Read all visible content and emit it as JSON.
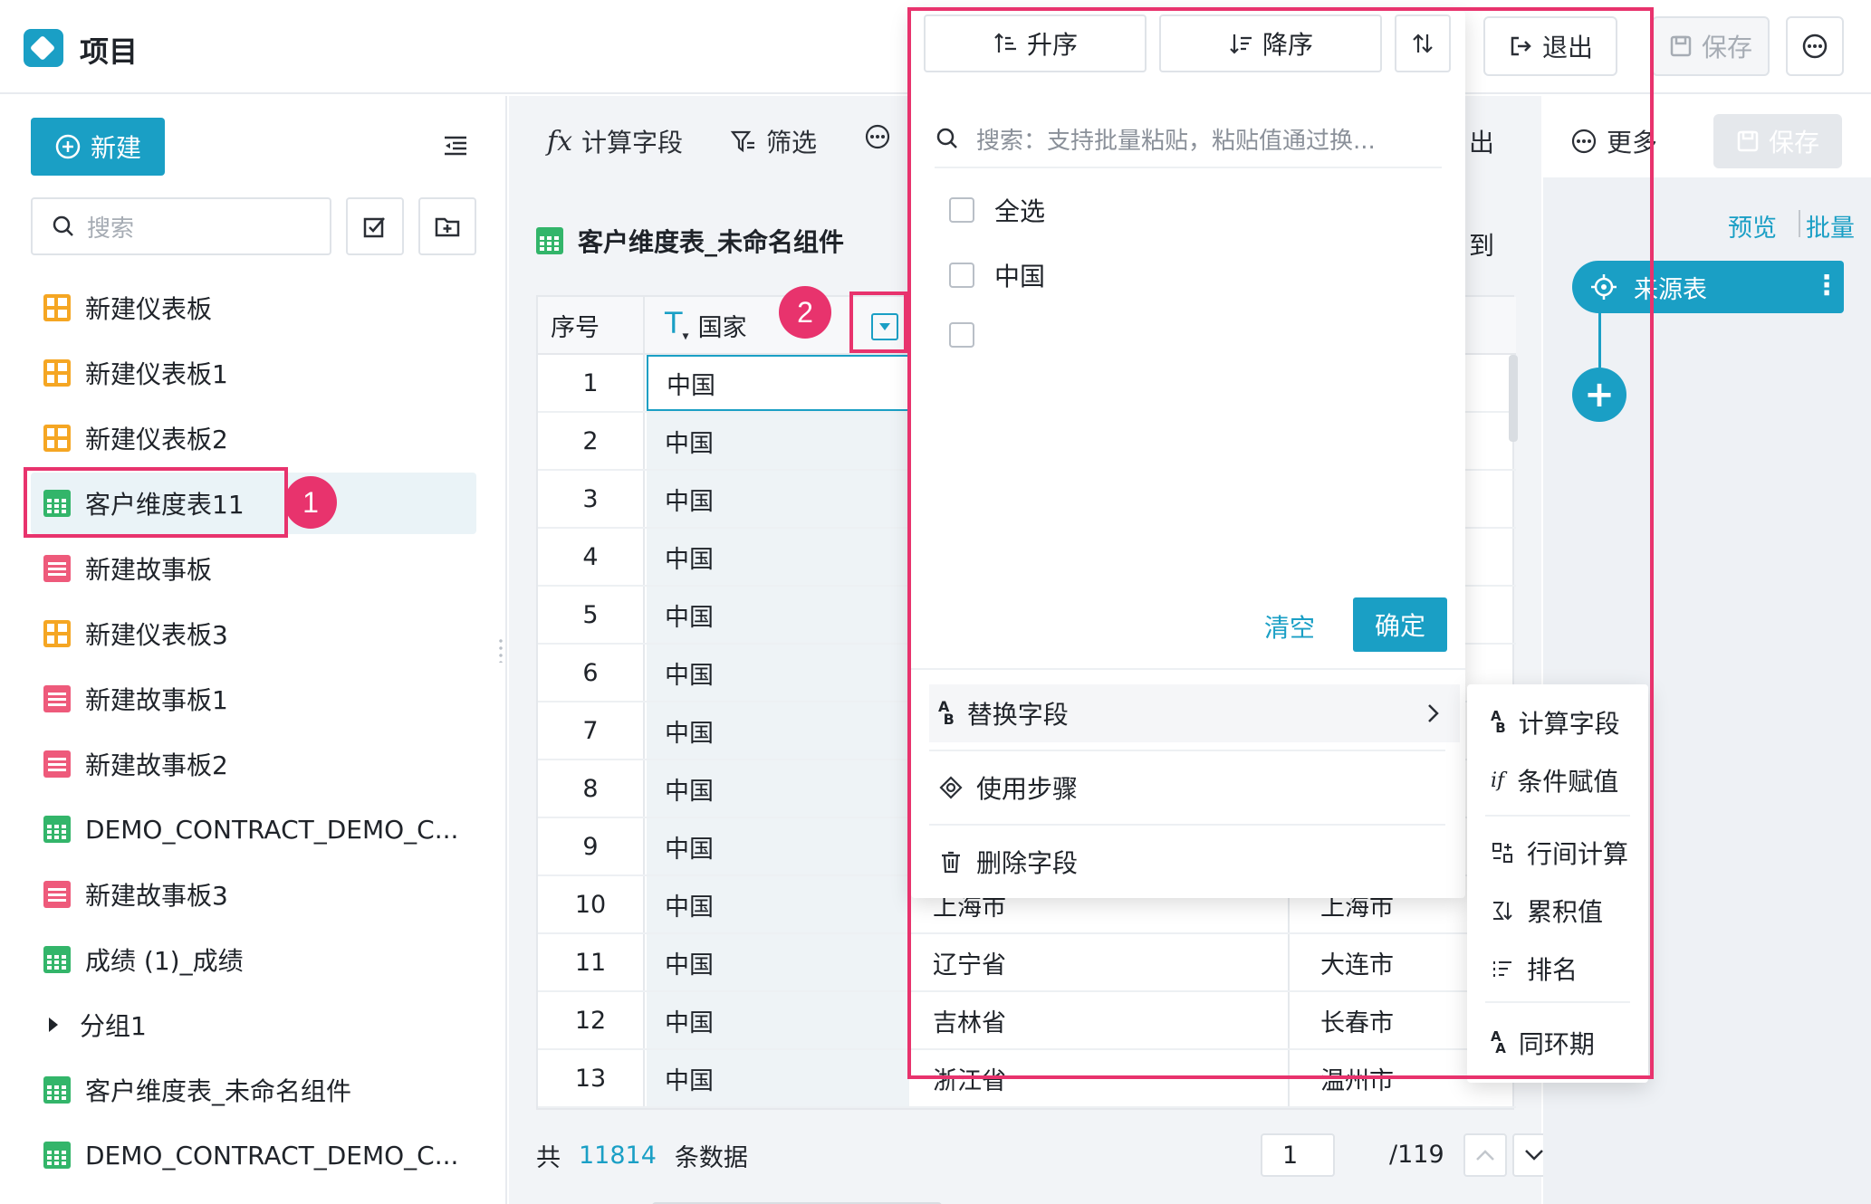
{
  "app": {
    "title": "项目"
  },
  "topbar": {
    "exit_label": "退出",
    "save_label": "保存"
  },
  "sidebar": {
    "new_label": "新建",
    "search_placeholder": "搜索",
    "items": [
      {
        "label": "新建仪表板",
        "type": "dashboard"
      },
      {
        "label": "新建仪表板1",
        "type": "dashboard"
      },
      {
        "label": "新建仪表板2",
        "type": "dashboard"
      },
      {
        "label": "客户维度表11",
        "type": "table"
      },
      {
        "label": "新建故事板",
        "type": "story"
      },
      {
        "label": "新建仪表板3",
        "type": "dashboard"
      },
      {
        "label": "新建故事板1",
        "type": "story"
      },
      {
        "label": "新建故事板2",
        "type": "story"
      },
      {
        "label": "DEMO_CONTRACT_DEMO_C...",
        "type": "table"
      },
      {
        "label": "新建故事板3",
        "type": "story"
      },
      {
        "label": "成绩 (1)_成绩",
        "type": "table"
      },
      {
        "label": "分组1",
        "type": "group"
      },
      {
        "label": "客户维度表_未命名组件",
        "type": "table"
      },
      {
        "label": "DEMO_CONTRACT_DEMO_C...",
        "type": "table"
      }
    ]
  },
  "toolbar": {
    "calc_field": "计算字段",
    "filter": "筛选",
    "export_partial": "出",
    "more": "更多",
    "save": "保存"
  },
  "component": {
    "title": "客户维度表_未命名组件",
    "right_partial": "到"
  },
  "table": {
    "headers": {
      "index": "序号",
      "country": "国家"
    },
    "rows": [
      {
        "i": "1",
        "country": "中国",
        "c3": "",
        "c4": ""
      },
      {
        "i": "2",
        "country": "中国",
        "c3": "",
        "c4": ""
      },
      {
        "i": "3",
        "country": "中国",
        "c3": "",
        "c4": ""
      },
      {
        "i": "4",
        "country": "中国",
        "c3": "",
        "c4": ""
      },
      {
        "i": "5",
        "country": "中国",
        "c3": "",
        "c4": ""
      },
      {
        "i": "6",
        "country": "中国",
        "c3": "",
        "c4": ""
      },
      {
        "i": "7",
        "country": "中国",
        "c3": "",
        "c4": ""
      },
      {
        "i": "8",
        "country": "中国",
        "c3": "",
        "c4": ""
      },
      {
        "i": "9",
        "country": "中国",
        "c3": "",
        "c4": ""
      },
      {
        "i": "10",
        "country": "中国",
        "c3": "上海市",
        "c4": "上海市"
      },
      {
        "i": "11",
        "country": "中国",
        "c3": "辽宁省",
        "c4": "大连市"
      },
      {
        "i": "12",
        "country": "中国",
        "c3": "吉林省",
        "c4": "长春市"
      },
      {
        "i": "13",
        "country": "中国",
        "c3": "浙江省",
        "c4": "温州市"
      }
    ]
  },
  "footer": {
    "prefix": "共",
    "count": "11814",
    "suffix": "条数据",
    "page": "1",
    "total": "/119"
  },
  "right_panel": {
    "preview": "预览",
    "batch": "批量",
    "source_node": "来源表"
  },
  "popup": {
    "asc": "升序",
    "desc": "降序",
    "search_placeholder": "搜索：支持批量粘贴，粘贴值通过换...",
    "options": [
      {
        "label": "全选"
      },
      {
        "label": "中国"
      },
      {
        "label": ""
      }
    ],
    "clear": "清空",
    "confirm": "确定",
    "menu": {
      "replace": "替换字段",
      "use_steps": "使用步骤",
      "delete": "删除字段"
    }
  },
  "submenu": {
    "calc_field": "计算字段",
    "conditional": "条件赋值",
    "row_calc": "行间计算",
    "cumulative": "累积值",
    "rank": "排名",
    "yoy": "同环期"
  },
  "badges": {
    "one": "1",
    "two": "2"
  },
  "colors": {
    "accent": "#1a9fc5",
    "highlight": "#e8336d",
    "dashboard": "#f5a623",
    "table": "#33b56a",
    "story": "#ee5a7b"
  }
}
